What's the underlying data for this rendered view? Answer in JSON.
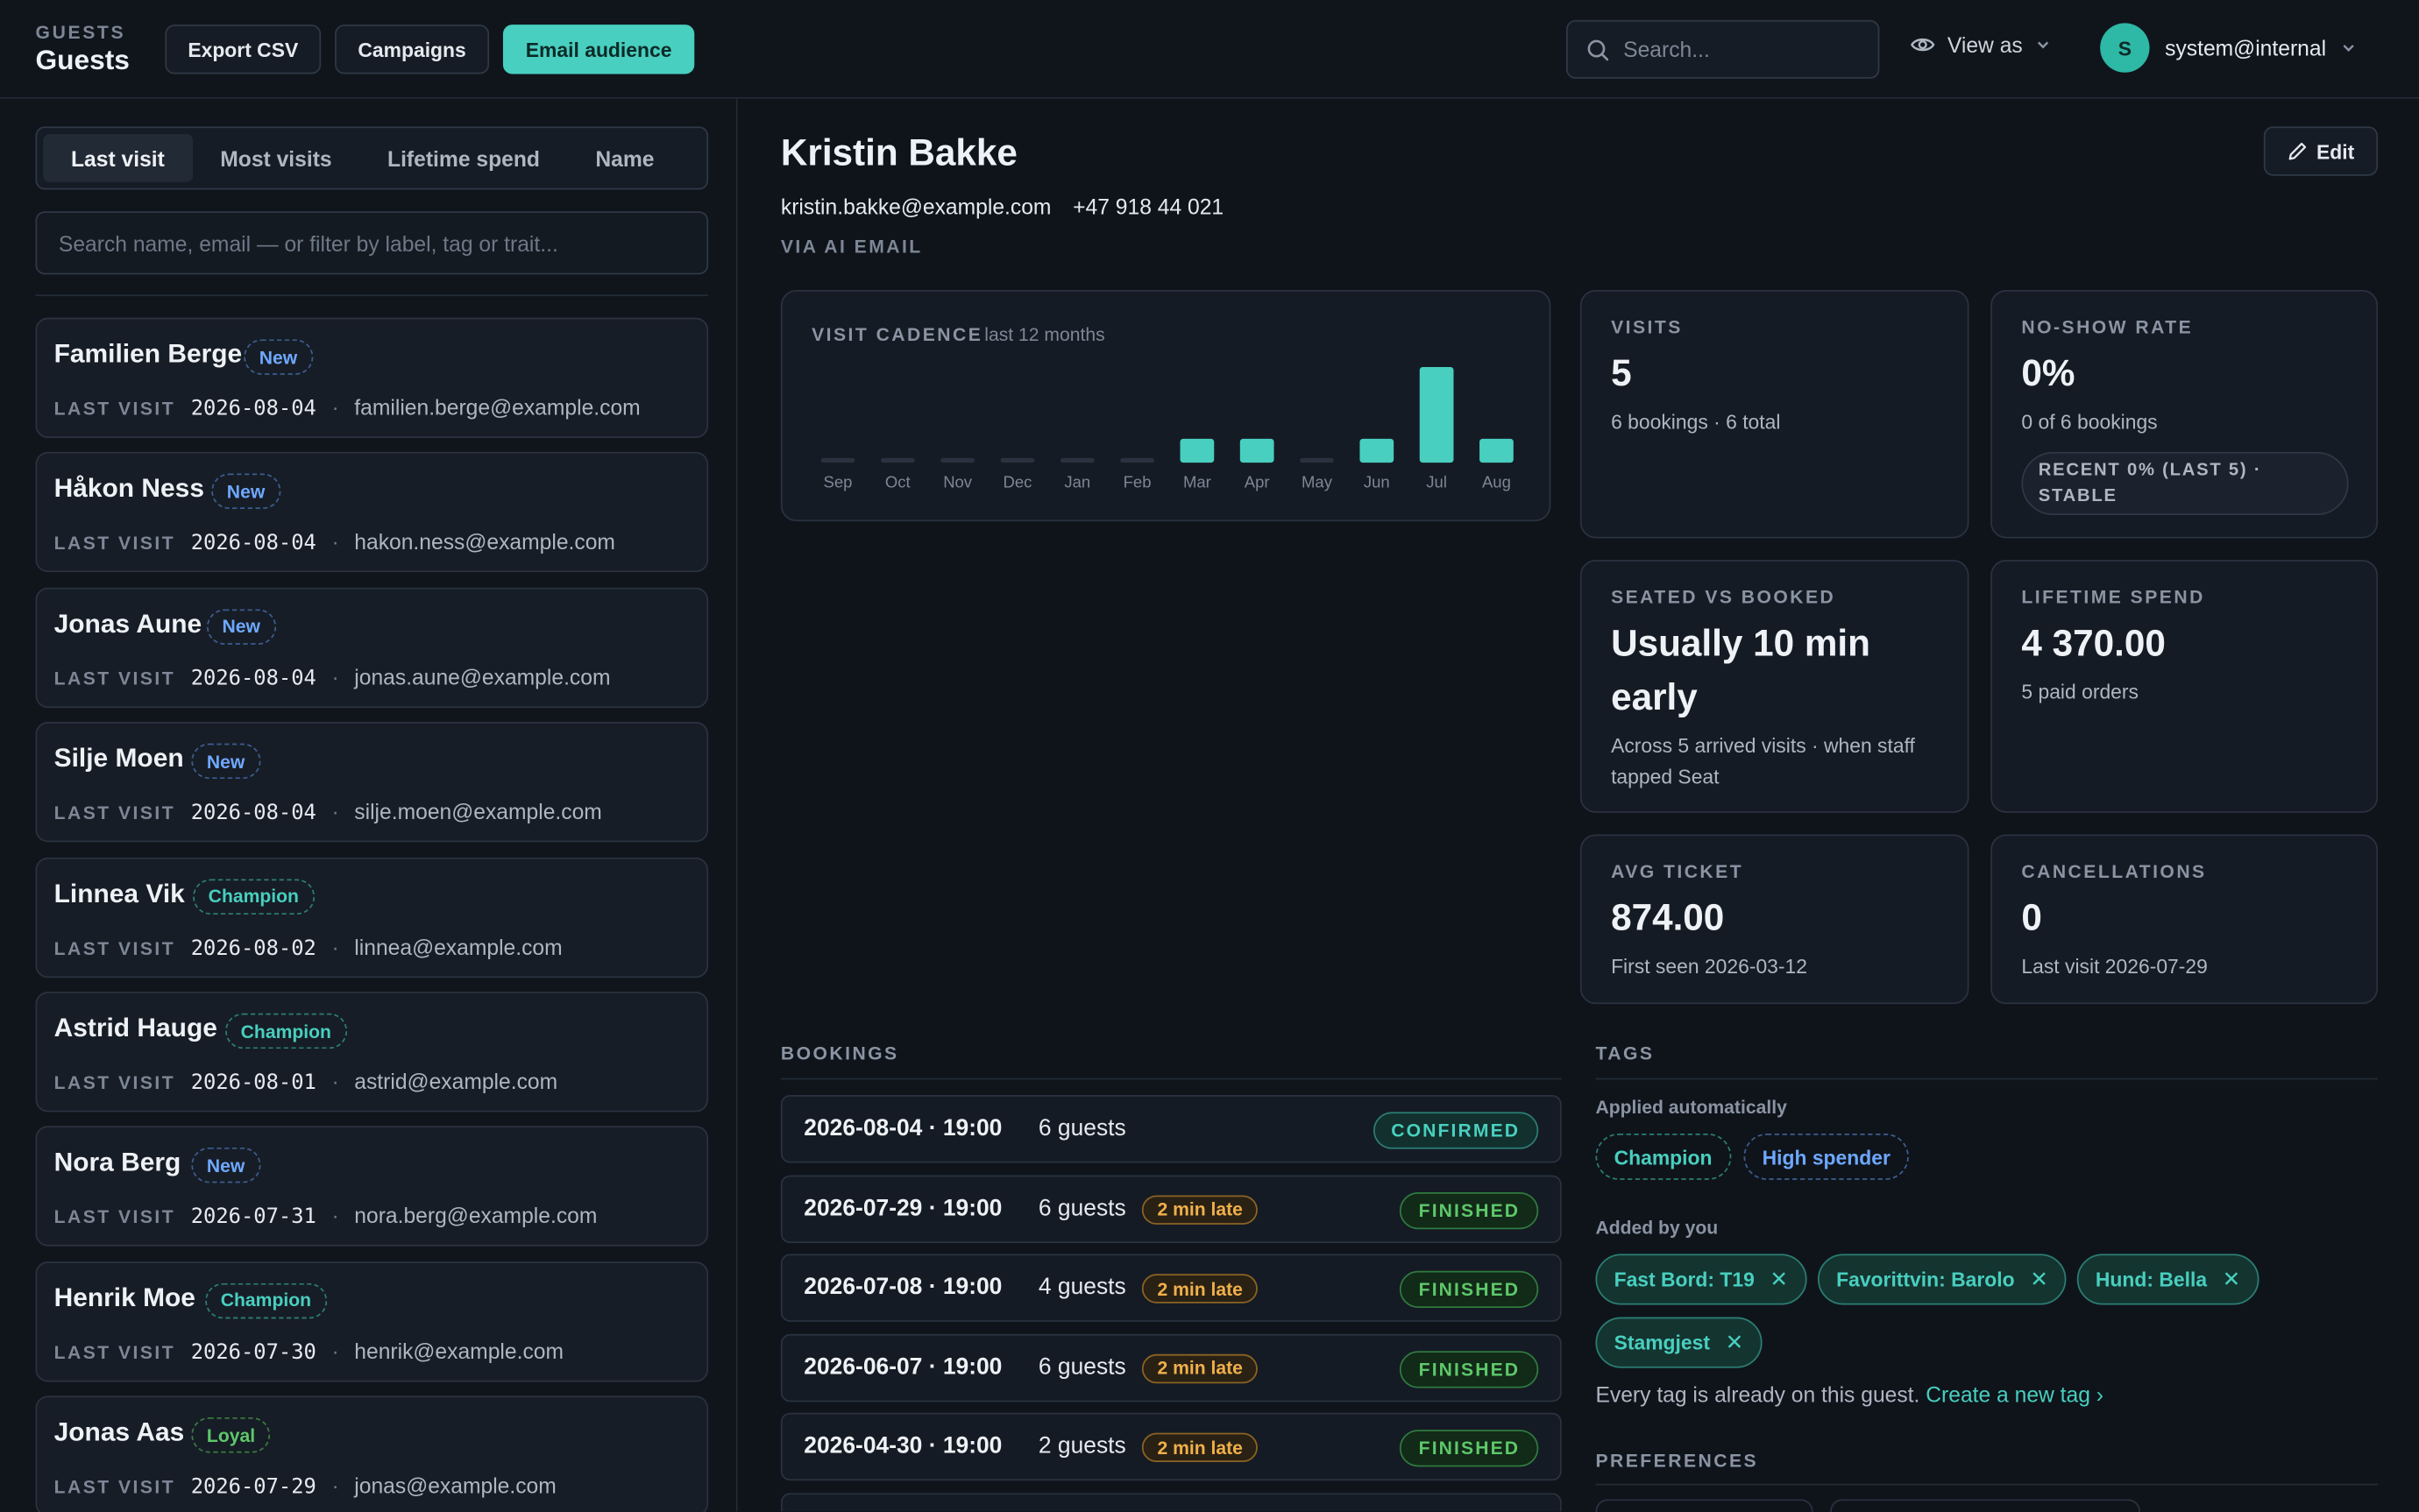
{
  "header": {
    "section_small": "GUESTS",
    "section_title": "Guests",
    "export_label": "Export CSV",
    "campaigns_label": "Campaigns",
    "email_label": "Email audience",
    "search_placeholder": "Search...",
    "view_as_label": "View as",
    "user_initial": "S",
    "user_email": "system@internal"
  },
  "sidebar": {
    "sort_tabs": [
      "Last visit",
      "Most visits",
      "Lifetime spend",
      "Name"
    ],
    "active_sort": "Last visit",
    "search_placeholder": "Search name, email — or filter by label, tag or trait...",
    "last_visit_label": "LAST VISIT",
    "guests": [
      {
        "name": "Familien Berge",
        "badge": "New",
        "date": "2026-08-04",
        "email": "familien.berge@example.com"
      },
      {
        "name": "Håkon Ness",
        "badge": "New",
        "date": "2026-08-04",
        "email": "hakon.ness@example.com"
      },
      {
        "name": "Jonas Aune",
        "badge": "New",
        "date": "2026-08-04",
        "email": "jonas.aune@example.com"
      },
      {
        "name": "Silje Moen",
        "badge": "New",
        "date": "2026-08-04",
        "email": "silje.moen@example.com"
      },
      {
        "name": "Linnea Vik",
        "badge": "Champion",
        "date": "2026-08-02",
        "email": "linnea@example.com"
      },
      {
        "name": "Astrid Hauge",
        "badge": "Champion",
        "date": "2026-08-01",
        "email": "astrid@example.com"
      },
      {
        "name": "Nora Berg",
        "badge": "New",
        "date": "2026-07-31",
        "email": "nora.berg@example.com"
      },
      {
        "name": "Henrik Moe",
        "badge": "Champion",
        "date": "2026-07-30",
        "email": "henrik@example.com"
      },
      {
        "name": "Jonas Aas",
        "badge": "Loyal",
        "date": "2026-07-29",
        "email": "jonas@example.com"
      }
    ]
  },
  "guest": {
    "name": "Kristin Bakke",
    "email": "kristin.bakke@example.com",
    "phone": "+47 918 44 021",
    "source": "VIA AI EMAIL",
    "edit_label": "Edit"
  },
  "cadence": {
    "label": "VISIT CADENCE",
    "sublabel": "last 12 months"
  },
  "chart_data": {
    "type": "bar",
    "categories": [
      "Sep",
      "Oct",
      "Nov",
      "Dec",
      "Jan",
      "Feb",
      "Mar",
      "Apr",
      "May",
      "Jun",
      "Jul",
      "Aug"
    ],
    "values": [
      0,
      0,
      0,
      0,
      0,
      0,
      1,
      1,
      0,
      1,
      2,
      1
    ],
    "colors": {
      "bar": "#48cfbf",
      "empty": "#2a3240"
    }
  },
  "stats": {
    "visits": {
      "label": "VISITS",
      "value": "5",
      "sub": "6 bookings · 6 total"
    },
    "noshow": {
      "label": "NO-SHOW RATE",
      "value": "0%",
      "sub": "0 of 6 bookings",
      "pill": "RECENT 0% (LAST 5) · STABLE"
    },
    "seated": {
      "label": "SEATED VS BOOKED",
      "value_line1": "Usually 10 min",
      "value_line2": "early",
      "sub_line1": "Across 5 arrived visits · when staff",
      "sub_line2": "tapped Seat"
    },
    "lifetime": {
      "label": "LIFETIME SPEND",
      "value": "4 370.00",
      "sub": "5 paid orders"
    },
    "avg_ticket": {
      "label": "AVG TICKET",
      "value": "874.00",
      "sub": "First seen 2026-03-12"
    },
    "cancellations": {
      "label": "CANCELLATIONS",
      "value": "0",
      "sub": "Last visit 2026-07-29"
    }
  },
  "bookings": {
    "label": "BOOKINGS",
    "rows": [
      {
        "datetime": "2026-08-04 · 19:00",
        "guests": "6 guests",
        "late": "",
        "status": "CONFIRMED"
      },
      {
        "datetime": "2026-07-29 · 19:00",
        "guests": "6 guests",
        "late": "2 min late",
        "status": "FINISHED"
      },
      {
        "datetime": "2026-07-08 · 19:00",
        "guests": "4 guests",
        "late": "2 min late",
        "status": "FINISHED"
      },
      {
        "datetime": "2026-06-07 · 19:00",
        "guests": "6 guests",
        "late": "2 min late",
        "status": "FINISHED"
      },
      {
        "datetime": "2026-04-30 · 19:00",
        "guests": "2 guests",
        "late": "2 min late",
        "status": "FINISHED"
      }
    ]
  },
  "tags": {
    "label": "TAGS",
    "auto_label": "Applied automatically",
    "auto": [
      "Champion",
      "High spender"
    ],
    "user_label": "Added by you",
    "user": [
      "Fast Bord: T19",
      "Favorittvin: Barolo",
      "Hund: Bella",
      "Stamgjest"
    ],
    "note": "Every tag is already on this guest.",
    "create_link": "Create a new tag ›"
  },
  "preferences": {
    "label": "PREFERENCES"
  }
}
